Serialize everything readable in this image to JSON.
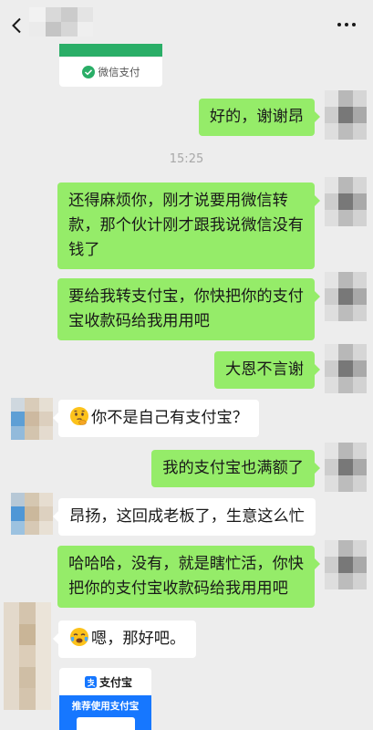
{
  "header": {
    "back_icon": "back-arrow-icon",
    "more_icon": "more-dots-icon"
  },
  "theme": {
    "background": "#ededed",
    "self_bubble": "#95ec69",
    "other_bubble": "#ffffff",
    "text": "#191919",
    "timestamp": "#a8a8a8",
    "wechat_green": "#2aae67",
    "alipay_blue": "#1677ff"
  },
  "wechat_pay_card": {
    "icon": "wechat-pay-icon",
    "label": "微信支付"
  },
  "timestamp": "15:25",
  "messages": [
    {
      "lines": [
        "好的，谢谢昂"
      ]
    },
    {
      "lines": [
        "还得麻烦你，刚才说要用微信转",
        "款，那个伙计刚才跟我说微信没有",
        "钱了"
      ]
    },
    {
      "lines": [
        "要给我转支付宝，你快把你的支付",
        "宝收款码给我用用吧"
      ]
    },
    {
      "lines": [
        "大恩不言谢"
      ]
    },
    {
      "icon": "thinking-face-emoji-icon",
      "lines": [
        "你不是自己有支付宝？"
      ]
    },
    {
      "lines": [
        "我的支付宝也满额了"
      ]
    },
    {
      "lines": [
        "昂扬，这回成老板了，生意这么忙"
      ]
    },
    {
      "lines": [
        "哈哈哈，没有，就是瞎忙活，你快",
        "把你的支付宝收款码给我用用吧"
      ]
    },
    {
      "icon": "sweat-tears-emoji-icon",
      "lines": [
        "嗯，那好吧。"
      ]
    }
  ],
  "alipay_card": {
    "logo_icon": "alipay-logo-icon",
    "brand": "支付宝",
    "banner": "推荐使用支付宝"
  }
}
